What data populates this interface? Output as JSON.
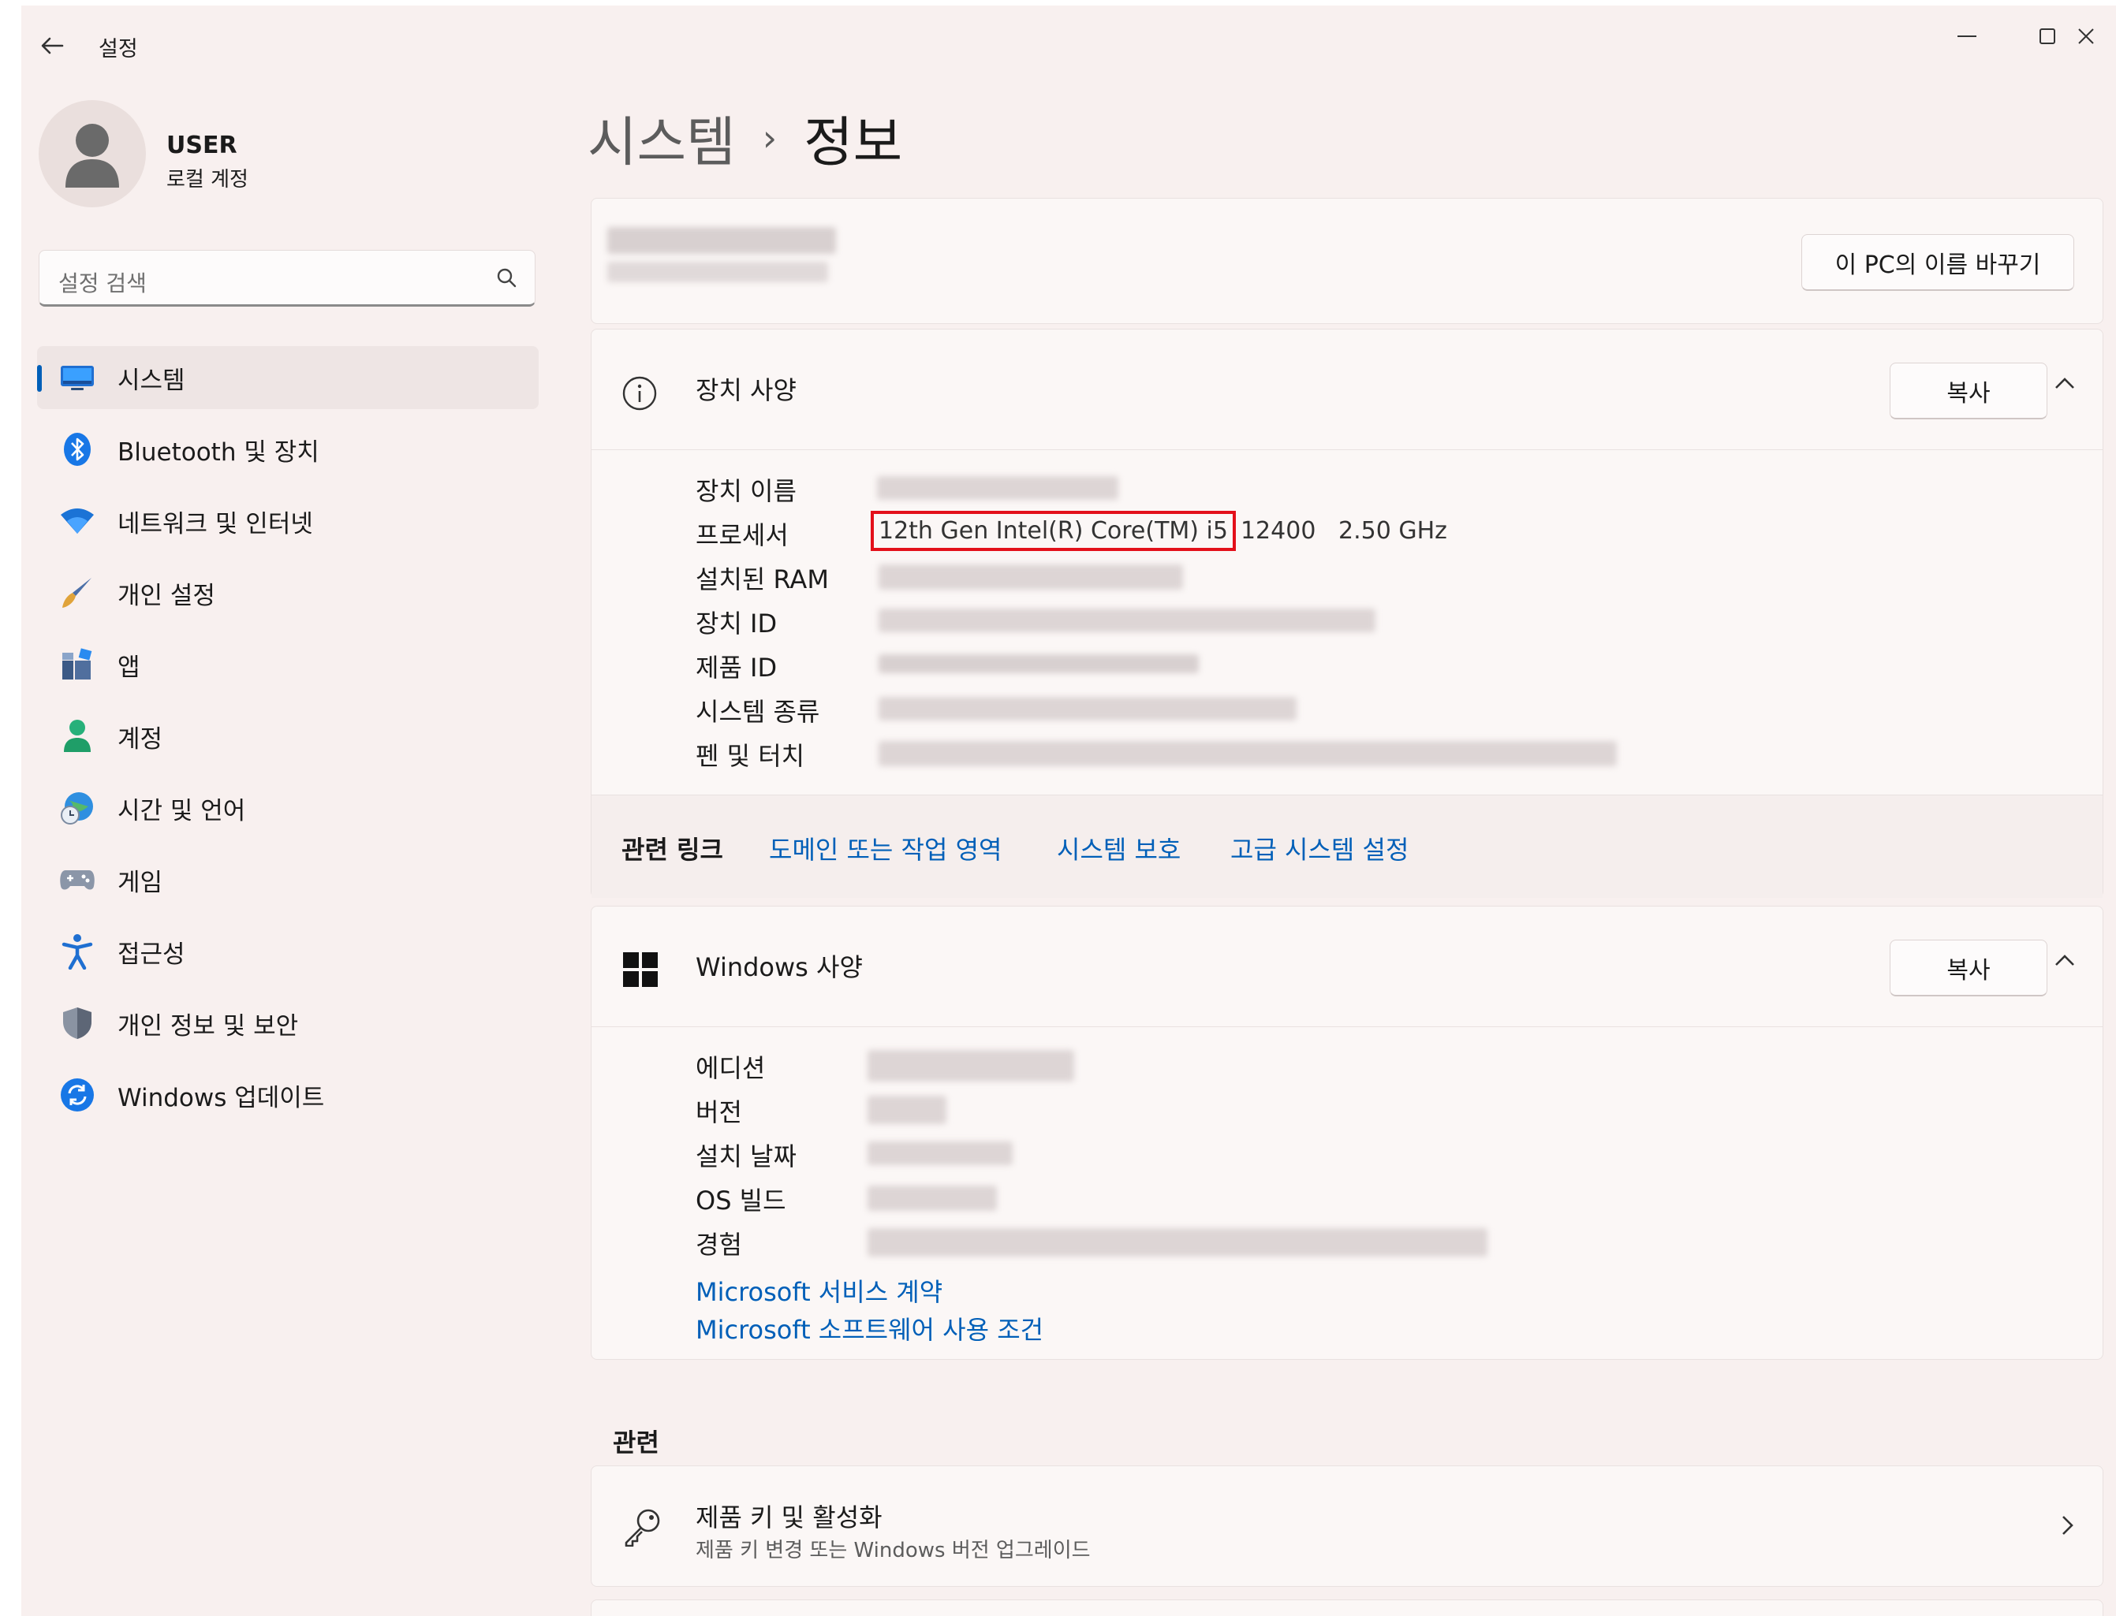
{
  "window": {
    "app_title": "설정",
    "controls": {
      "minimize": "—",
      "maximize": "☐",
      "close": "✕"
    }
  },
  "user": {
    "name": "USER",
    "account_type": "로컬 계정"
  },
  "search": {
    "placeholder": "설정 검색"
  },
  "nav": {
    "items": [
      {
        "label": "시스템",
        "icon": "monitor-icon",
        "active": true
      },
      {
        "label": "Bluetooth 및 장치",
        "icon": "bluetooth-icon"
      },
      {
        "label": "네트워크 및 인터넷",
        "icon": "wifi-icon"
      },
      {
        "label": "개인 설정",
        "icon": "brush-icon"
      },
      {
        "label": "앱",
        "icon": "apps-icon"
      },
      {
        "label": "계정",
        "icon": "person-icon"
      },
      {
        "label": "시간 및 언어",
        "icon": "globe-clock-icon"
      },
      {
        "label": "게임",
        "icon": "gamepad-icon"
      },
      {
        "label": "접근성",
        "icon": "accessibility-icon"
      },
      {
        "label": "개인 정보 및 보안",
        "icon": "shield-icon"
      },
      {
        "label": "Windows 업데이트",
        "icon": "update-icon"
      }
    ]
  },
  "page": {
    "parent": "시스템",
    "separator": "›",
    "current": "정보"
  },
  "pc_card": {
    "rename_label": "이 PC의 이름 바꾸기"
  },
  "device_specs": {
    "title": "장치 사양",
    "copy_label": "복사",
    "rows": [
      {
        "label": "장치 이름"
      },
      {
        "label": "프로세서",
        "value_highlighted": "12th Gen Intel(R) Core(TM) i5",
        "value_rest": "12400   2.50 GHz"
      },
      {
        "label": "설치된 RAM"
      },
      {
        "label": "장치 ID"
      },
      {
        "label": "제품 ID"
      },
      {
        "label": "시스템 종류"
      },
      {
        "label": "펜 및 터치"
      }
    ],
    "related_links": {
      "title": "관련 링크",
      "links": [
        "도메인 또는 작업 영역",
        "시스템 보호",
        "고급 시스템 설정"
      ]
    }
  },
  "windows_specs": {
    "title": "Windows 사양",
    "copy_label": "복사",
    "rows": [
      {
        "label": "에디션"
      },
      {
        "label": "버전"
      },
      {
        "label": "설치 날짜"
      },
      {
        "label": "OS 빌드"
      },
      {
        "label": "경험"
      }
    ],
    "links": [
      "Microsoft 서비스 계약",
      "Microsoft 소프트웨어 사용 조건"
    ]
  },
  "related": {
    "heading": "관련",
    "product_key": {
      "title": "제품 키 및 활성화",
      "subtitle": "제품 키 변경 또는 Windows 버전 업그레이드"
    }
  },
  "colors": {
    "accent": "#005fb8",
    "highlight_box": "#e3101a",
    "background": "#f8f0ef"
  }
}
